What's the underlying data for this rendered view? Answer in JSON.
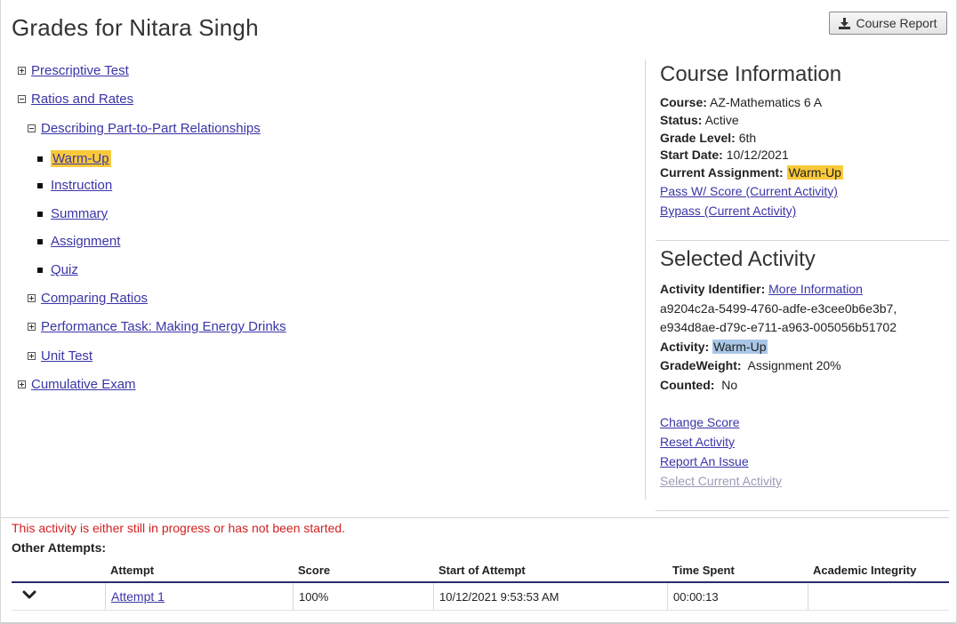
{
  "page": {
    "title": "Grades for Nitara Singh"
  },
  "toolbar": {
    "course_report_label": "Course Report",
    "download_icon": "download-icon"
  },
  "tree": {
    "prescriptive_test": "Prescriptive Test",
    "ratios_and_rates": "Ratios and Rates",
    "describing": "Describing Part-to-Part Relationships",
    "warm_up": "Warm-Up",
    "instruction": "Instruction",
    "summary": "Summary",
    "assignment": "Assignment",
    "quiz": "Quiz",
    "comparing_ratios": "Comparing Ratios",
    "performance_task": "Performance Task: Making Energy Drinks",
    "unit_test": "Unit Test",
    "cumulative_exam": "Cumulative Exam"
  },
  "course_info": {
    "heading": "Course Information",
    "course_label": "Course:",
    "course_value": "AZ-Mathematics 6 A",
    "status_label": "Status:",
    "status_value": "Active",
    "grade_label": "Grade Level:",
    "grade_value": "6th",
    "start_label": "Start Date:",
    "start_value": "10/12/2021",
    "current_label": "Current Assignment:",
    "current_value": "Warm-Up",
    "pass_link": "Pass W/ Score (Current Activity)",
    "bypass_link": "Bypass (Current Activity)"
  },
  "selected_activity": {
    "heading": "Selected Activity",
    "identifier_label": "Activity Identifier:",
    "more_info_link": "More Information",
    "identifier_line1": "a9204c2a-5499-4760-adfe-e3cee0b6e3b7,",
    "identifier_line2": "e934d8ae-d79c-e711-a963-005056b51702",
    "activity_label": "Activity:",
    "activity_value": "Warm-Up",
    "gradeweight_label": "GradeWeight:",
    "gradeweight_value": "Assignment 20%",
    "counted_label": "Counted:",
    "counted_value": "No",
    "change_score": "Change Score",
    "reset_activity": "Reset Activity",
    "report_issue": "Report An Issue",
    "select_current": "Select Current Activity"
  },
  "status_message": "This activity is either still in progress or has not been started.",
  "attempts": {
    "heading": "Other Attempts:",
    "columns": [
      "Attempt",
      "Score",
      "Start of Attempt",
      "Time Spent",
      "Academic Integrity"
    ],
    "rows": [
      {
        "attempt": "Attempt 1",
        "score": "100%",
        "start": "10/12/2021 9:53:53 AM",
        "time_spent": "00:00:13",
        "integrity": ""
      }
    ]
  },
  "colors": {
    "link": "#3a35a6",
    "highlight_yellow": "#f9c93a",
    "highlight_blue": "#a9c6e6",
    "error": "#d31f1f",
    "table_rule": "#2b2a6e"
  }
}
